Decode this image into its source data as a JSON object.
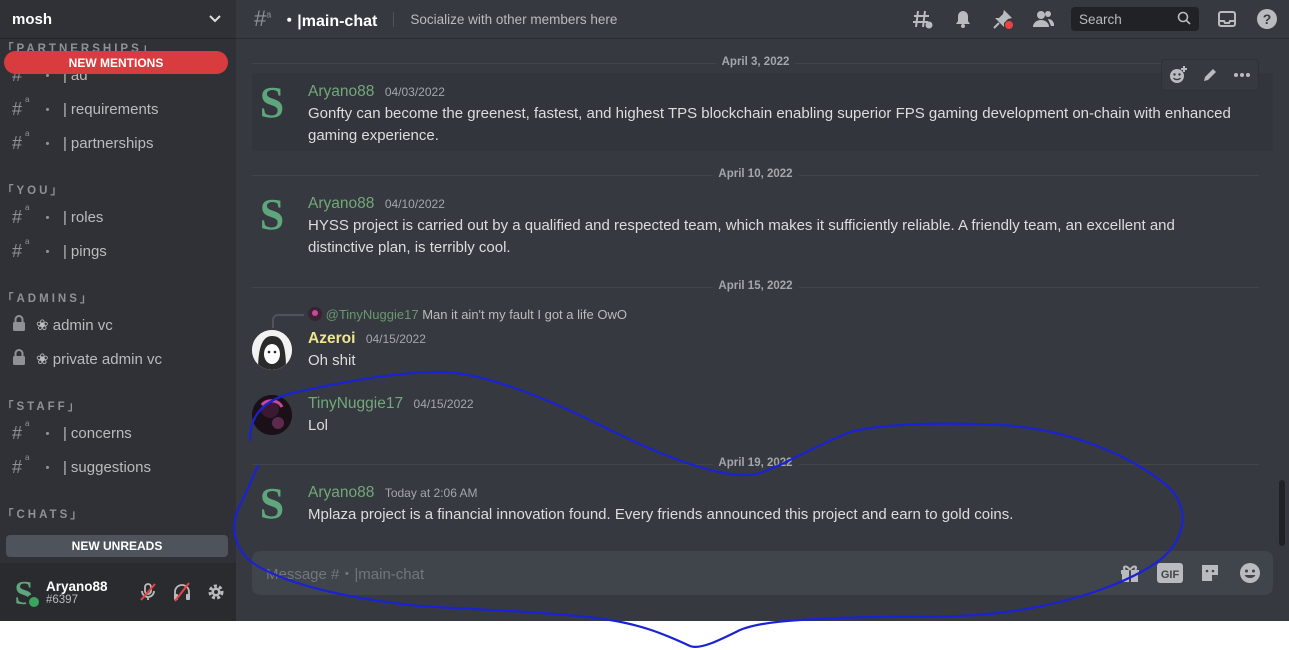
{
  "server": {
    "name": "mosh"
  },
  "sidebar": {
    "categories": [
      {
        "label": "「PARTNERSHIPS」"
      },
      {
        "label": "「YOU」"
      },
      {
        "label": "「ADMINS」"
      },
      {
        "label": "「STAFF」"
      },
      {
        "label": "「CHATS」"
      }
    ],
    "channels": {
      "ad": "ad",
      "requirements": "requirements",
      "partnerships": "partnerships",
      "roles": "roles",
      "pings": "pings",
      "admin_vc": "❀ admin vc",
      "private_admin_vc": "❀ private admin vc",
      "concerns": "concerns",
      "suggestions": "suggestions"
    },
    "sep": "・",
    "bar": "|",
    "new_mentions": "NEW MENTIONS",
    "new_unreads": "NEW UNREADS"
  },
  "user": {
    "name": "Aryano88",
    "tag": "#6397"
  },
  "header": {
    "channel": "・|main-chat",
    "topic": "Socialize with other members here",
    "search_placeholder": "Search"
  },
  "messages": {
    "d1": "April 3, 2022",
    "m1": {
      "author": "Aryano88",
      "time": "04/03/2022",
      "text": "Gonfty can become the greenest, fastest, and highest TPS blockchain enabling superior FPS gaming development on-chain with enhanced gaming experience."
    },
    "d2": "April 10, 2022",
    "m2": {
      "author": "Aryano88",
      "time": "04/10/2022",
      "text": "HYSS project is carried out by a qualified and respected team, which makes it sufficiently reliable. A friendly team, an excellent and distinctive plan, is terribly cool."
    },
    "d3": "April 15, 2022",
    "reply": {
      "name": "@TinyNuggie17",
      "text": "Man it ain't my fault I got a life OwO"
    },
    "m3": {
      "author": "Azeroi",
      "time": "04/15/2022",
      "text": "Oh shit"
    },
    "m4": {
      "author": "TinyNuggie17",
      "time": "04/15/2022",
      "text": "Lol"
    },
    "d4": "April 19, 2022",
    "m5": {
      "author": "Aryano88",
      "time": "Today at 2:06 AM",
      "text": "Mplaza project is a financial innovation found. Every friends announced this project and earn to gold coins."
    }
  },
  "avatar_letter": "S",
  "composer": {
    "placeholder": "Message #・|main-chat"
  },
  "colors": {
    "accent_green": "#72a87a",
    "mention_red": "#d83c3e",
    "annotation_blue": "#1a22d6"
  }
}
